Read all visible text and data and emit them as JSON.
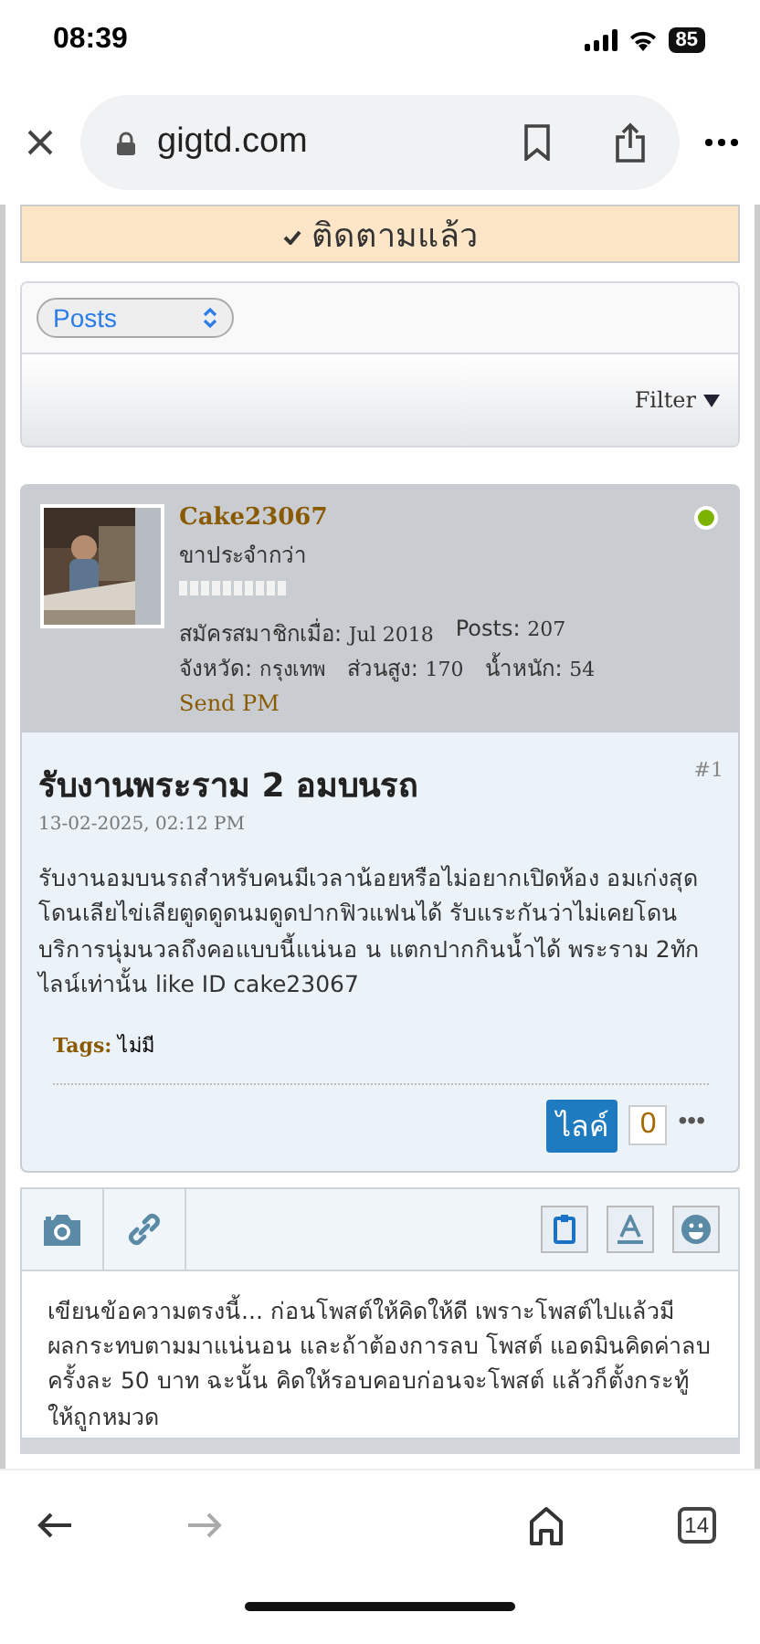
{
  "status_bar": {
    "time": "08:39",
    "battery": "85"
  },
  "browser": {
    "url": "gigtd.com",
    "tab_count": "14"
  },
  "follow_banner": {
    "label": "ติดตามแล้ว"
  },
  "posts_panel": {
    "select_value": "Posts",
    "filter_label": "Filter"
  },
  "post": {
    "author": {
      "name": "Cake23067",
      "rank": "ขาประจำกว่า",
      "online": true,
      "send_pm": "Send PM",
      "stats": [
        {
          "label": "สมัครสมาชิกเมื่อ:",
          "value": "Jul 2018"
        },
        {
          "label": "Posts:",
          "value": "207"
        },
        {
          "label": "จังหวัด:",
          "value": "กรุงเทพ"
        },
        {
          "label": "ส่วนสูง:",
          "value": "170"
        },
        {
          "label": "น้ำหนัก:",
          "value": "54"
        }
      ]
    },
    "number": "#1",
    "title": "รับงานพระราม 2 อมบนรถ",
    "date": "13-02-2025, 02:12 PM",
    "body": "รับงานอมบนรถสำหรับคนมีเวลาน้อยหรือไม่อยากเปิดห้อง อมเก่งสุด โดนเลียไข่เลียตูดดูดนมดูดปากฟิวแฟนได้ รับแระกันว่าไม่เคยโดน บริการนุ่มนวลถึงคอแบบนี้แน่นอ น แตกปากกินน้ำได้ พระราม 2ทักไลน์เท่านั้น like ID cake23067",
    "tags_label": "Tags:",
    "tags_value": "ไม่มี",
    "like_label": "ไลค์",
    "like_count": "0",
    "more": "•••"
  },
  "editor": {
    "placeholder": "เขียนข้อความตรงนี้... ก่อนโพสต์ให้คิดให้ดี เพราะโพสต์ไปแล้วมีผลกระทบตามมาแน่นอน และถ้าต้องการลบ โพสต์ แอดมินคิดค่าลบครั้งละ 50 บาท ฉะนั้น คิดให้รอบคอบก่อนจะโพสต์ แล้วก็ตั้งกระทู้ให้ถูกหมวด"
  }
}
